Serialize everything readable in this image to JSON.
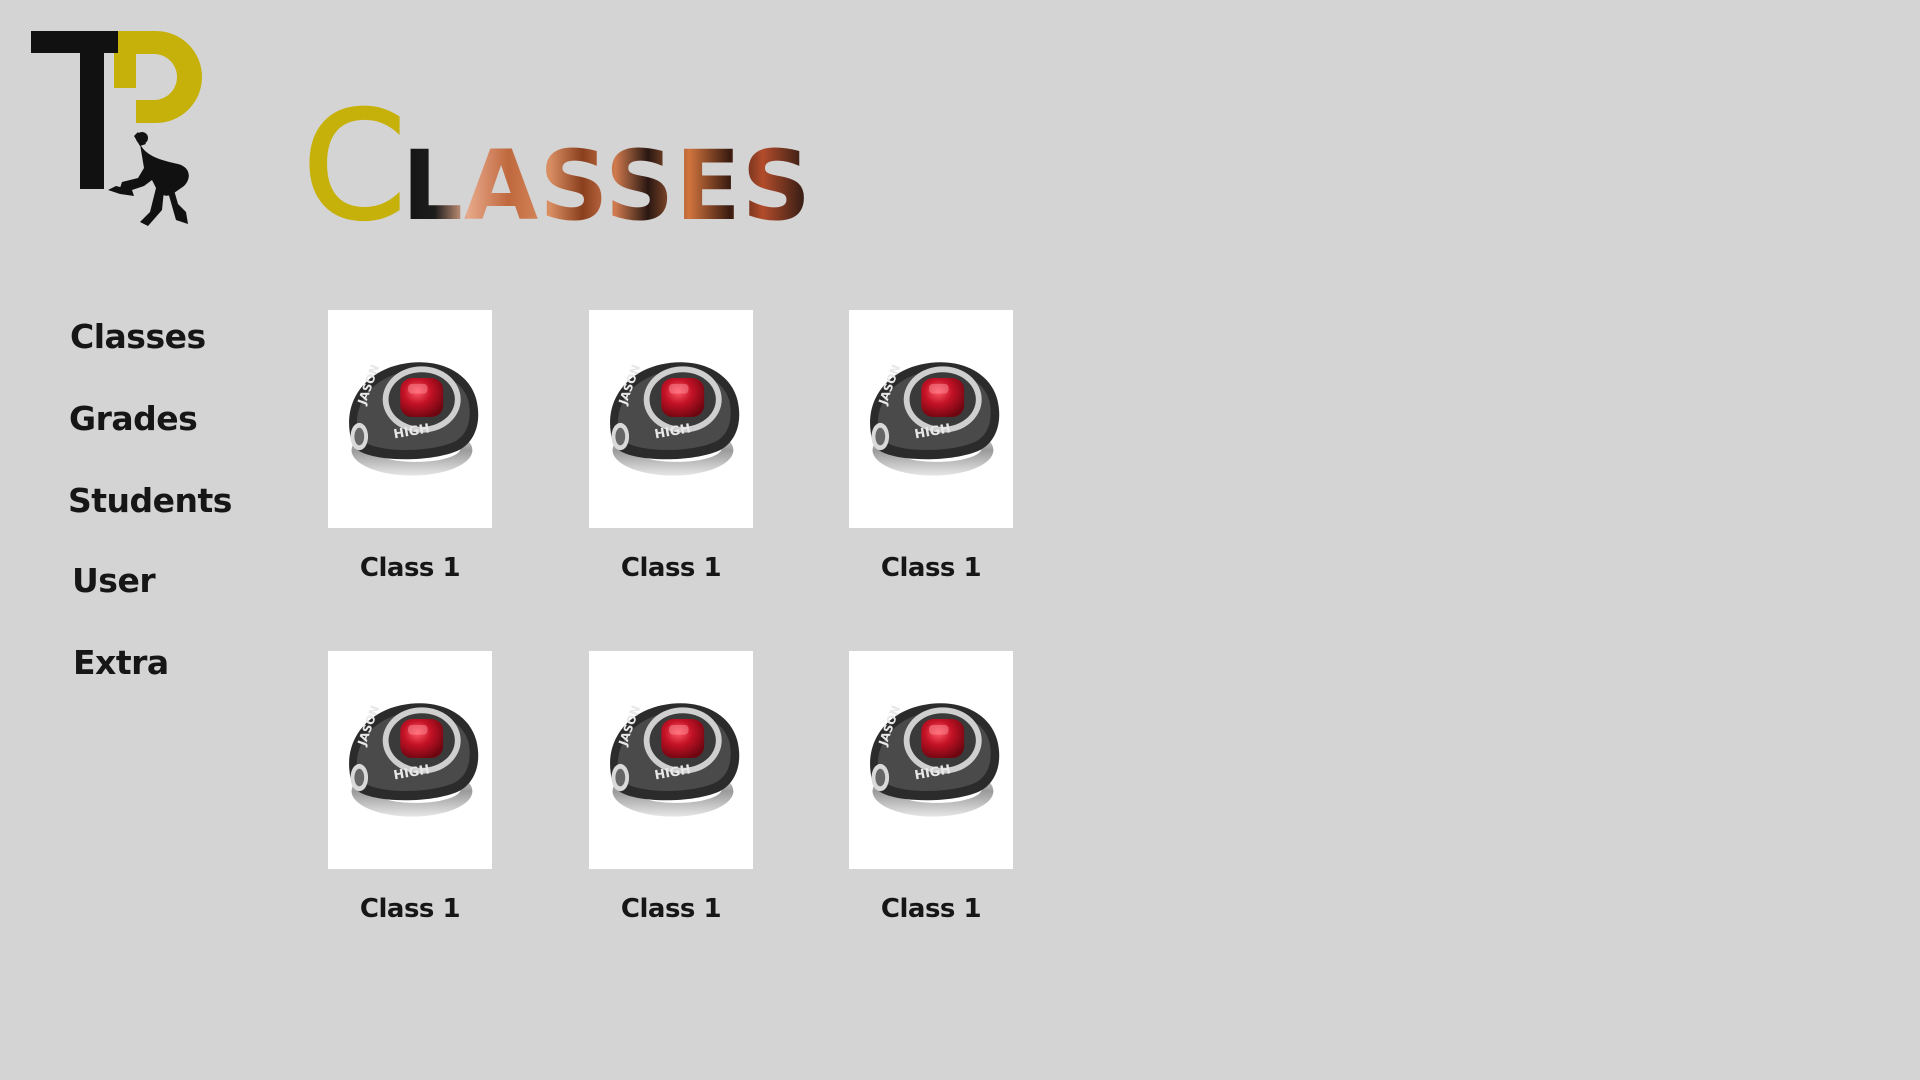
{
  "app": {
    "logo_icon": "tp-logo-climber-icon"
  },
  "page": {
    "title_initial": "C",
    "title_rest": "LASSES"
  },
  "colors": {
    "background": "#d4d4d4",
    "accent_gold": "#c6b10a",
    "text_dark": "#161616",
    "thumb_bg": "#ffffff",
    "ring_stone": "#c41226"
  },
  "sidebar": {
    "items": [
      {
        "label": "Classes"
      },
      {
        "label": "Grades"
      },
      {
        "label": "Students"
      },
      {
        "label": "User"
      },
      {
        "label": "Extra"
      }
    ]
  },
  "classes": [
    {
      "label": "Class 1",
      "image_icon": "class-ring-icon"
    },
    {
      "label": "Class 1",
      "image_icon": "class-ring-icon"
    },
    {
      "label": "Class 1",
      "image_icon": "class-ring-icon"
    },
    {
      "label": "Class 1",
      "image_icon": "class-ring-icon"
    },
    {
      "label": "Class 1",
      "image_icon": "class-ring-icon"
    },
    {
      "label": "Class 1",
      "image_icon": "class-ring-icon"
    }
  ]
}
